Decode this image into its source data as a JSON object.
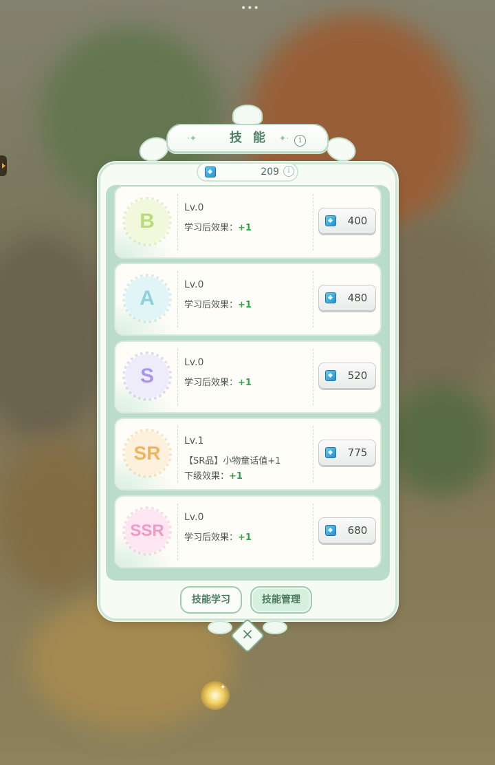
{
  "header": {
    "title": "技能",
    "info_icon": "i"
  },
  "currency": {
    "icon": "gem-icon",
    "value": "209",
    "info_icon": "i"
  },
  "skills": [
    {
      "grade": "B",
      "grade_color": "#c3e28a",
      "level": "Lv.0",
      "effect_label": "学习后效果：",
      "effect_value": "+1",
      "cost": "400"
    },
    {
      "grade": "A",
      "grade_color": "#9fdde4",
      "level": "Lv.0",
      "effect_label": "学习后效果：",
      "effect_value": "+1",
      "cost": "480"
    },
    {
      "grade": "S",
      "grade_color": "#b5a8ec",
      "level": "Lv.0",
      "effect_label": "学习后效果：",
      "effect_value": "+1",
      "cost": "520"
    },
    {
      "grade": "SR",
      "grade_color": "#f4c27a",
      "level": "Lv.1",
      "desc": "【SR品】小物童话值+1",
      "effect_label": "下级效果：",
      "effect_value": "+1",
      "cost": "775"
    },
    {
      "grade": "SSR",
      "grade_color": "#f4a9cf",
      "level": "Lv.0",
      "effect_label": "学习后效果：",
      "effect_value": "+1",
      "cost": "680"
    }
  ],
  "tabs": {
    "learn": "技能学习",
    "manage": "技能管理"
  },
  "close_icon": "×",
  "top_menu": "•••"
}
